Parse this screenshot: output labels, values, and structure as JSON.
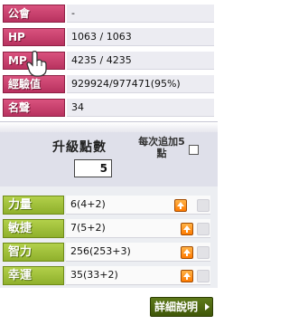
{
  "info": {
    "rows": [
      {
        "label": "公會",
        "value": "-"
      },
      {
        "label": "HP",
        "value": "1063 / 1063"
      },
      {
        "label": "MP",
        "value": "4235 / 4235"
      },
      {
        "label": "經驗值",
        "value": "929924/977471(95%)"
      },
      {
        "label": "名聲",
        "value": "34"
      }
    ]
  },
  "points": {
    "label": "升級點數",
    "value": "5",
    "auto_label": "每次追加5點"
  },
  "stats": [
    {
      "label": "力量",
      "value": "6(4+2)"
    },
    {
      "label": "敏捷",
      "value": "7(5+2)"
    },
    {
      "label": "智力",
      "value": "256(253+3)"
    },
    {
      "label": "幸運",
      "value": "35(33+2)"
    }
  ],
  "footer": {
    "detail_label": "詳細說明"
  },
  "colors": {
    "info_label": "#c43d6a",
    "stat_label": "#9fbe38",
    "up_button": "#ff8c00",
    "detail_button": "#4d6710"
  },
  "icons": {
    "up": "up-arrow-icon",
    "cursor": "hand-cursor-icon",
    "detail_arrow": "play-arrow-icon"
  }
}
